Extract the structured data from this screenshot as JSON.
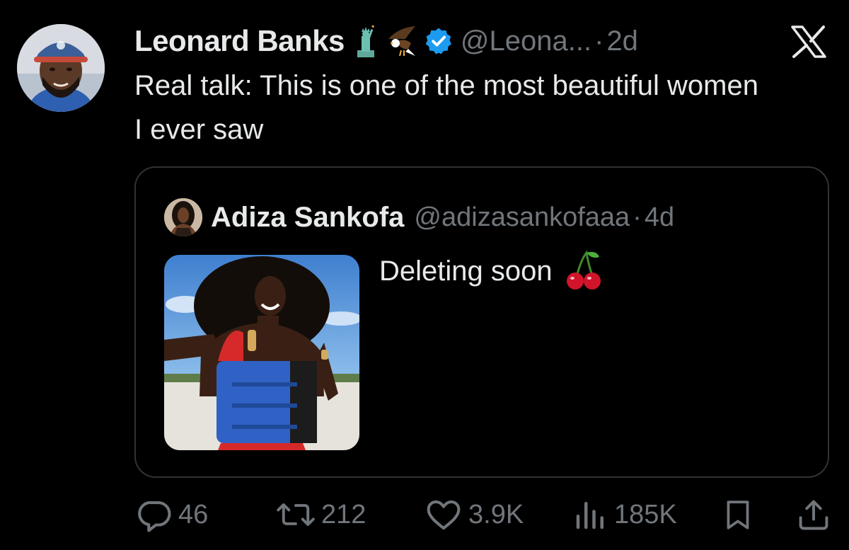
{
  "tweet": {
    "author_name": "Leonard Banks",
    "author_emojis": [
      "statue-of-liberty-icon",
      "eagle-icon"
    ],
    "verified": true,
    "handle": "@Leona...",
    "separator": "·",
    "time": "2d",
    "text": "Real talk: This is one of the most beautiful women I ever saw"
  },
  "quoted_tweet": {
    "author_name": "Adiza Sankofa",
    "handle": "@adizasankofaaa",
    "separator": "·",
    "time": "4d",
    "text": "Deleting soon",
    "text_emoji": "cherries-icon",
    "media": "photo"
  },
  "actions": {
    "replies": "46",
    "reposts": "212",
    "likes": "3.9K",
    "views": "185K"
  },
  "colors": {
    "background": "#000000",
    "primary_text": "#e7e9ea",
    "secondary_text": "#71767b",
    "border": "#2f3336",
    "verified_badge": "#1d9bf0"
  },
  "icons": [
    "x-logo-icon",
    "reply-icon",
    "repost-icon",
    "like-icon",
    "views-icon",
    "bookmark-icon",
    "share-icon"
  ]
}
